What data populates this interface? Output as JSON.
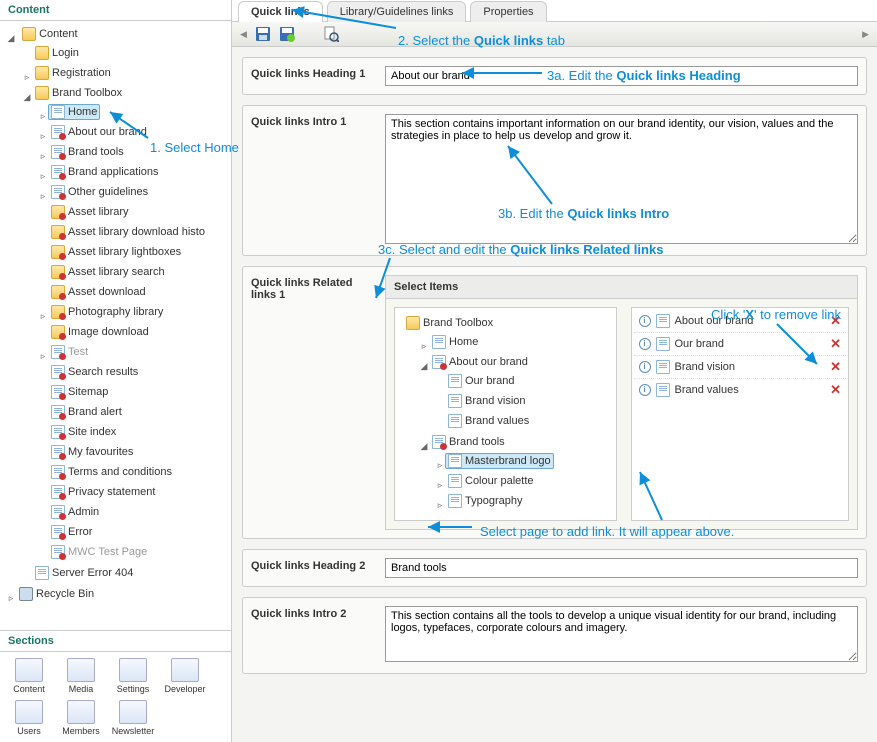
{
  "leftPanel": {
    "title": "Content",
    "tree": {
      "root": "Content",
      "login": "Login",
      "registration": "Registration",
      "brandToolbox": "Brand Toolbox",
      "home": "Home",
      "aboutBrand": "About our brand",
      "brandTools": "Brand tools",
      "brandApplications": "Brand applications",
      "otherGuidelines": "Other guidelines",
      "assetLibrary": "Asset library",
      "assetLibraryDownloadHistory": "Asset library download histo",
      "assetLibraryLightboxes": "Asset library lightboxes",
      "assetLibrarySearch": "Asset library search",
      "assetDownload": "Asset download",
      "photographyLibrary": "Photography library",
      "imageDownload": "Image download",
      "test": "Test",
      "searchResults": "Search results",
      "sitemap": "Sitemap",
      "brandAlert": "Brand alert",
      "siteIndex": "Site index",
      "myFavourites": "My favourites",
      "termsConditions": "Terms and conditions",
      "privacyStatement": "Privacy statement",
      "admin": "Admin",
      "error": "Error",
      "mwcTestPage": "MWC Test Page",
      "serverError": "Server Error 404",
      "recycleBin": "Recycle Bin"
    }
  },
  "sections": {
    "title": "Sections",
    "items": [
      "Content",
      "Media",
      "Settings",
      "Developer",
      "Users",
      "Members",
      "Newsletter"
    ]
  },
  "tabs": {
    "quickLinks": "Quick links",
    "libraryGuidelines": "Library/Guidelines links",
    "properties": "Properties"
  },
  "form": {
    "heading1Label": "Quick links Heading 1",
    "heading1Value": "About our brand",
    "intro1Label": "Quick links Intro 1",
    "intro1Value": "This section contains important information on our brand identity, our vision, values and the strategies in place to help us develop and grow it.",
    "relatedLinks1Label": "Quick links Related links 1",
    "selectItemsLabel": "Select Items",
    "heading2Label": "Quick links Heading 2",
    "heading2Value": "Brand tools",
    "intro2Label": "Quick links Intro 2",
    "intro2Value": "This section contains all the tools to develop a unique visual identity for our brand, including logos, typefaces, corporate colours and imagery."
  },
  "miniTree": {
    "brandToolbox": "Brand Toolbox",
    "home": "Home",
    "aboutOurBrand": "About our brand",
    "ourBrand": "Our brand",
    "brandVision": "Brand vision",
    "brandValues": "Brand values",
    "brandTools": "Brand tools",
    "masterbrandLogo": "Masterbrand logo",
    "colourPalette": "Colour palette",
    "typography": "Typography"
  },
  "selectedItems": [
    "About our brand",
    "Our brand",
    "Brand vision",
    "Brand values"
  ],
  "annotations": {
    "a1": "1. Select Home",
    "a2_pre": "2. Select the ",
    "a2_bold": "Quick links",
    "a2_post": " tab",
    "a3a_pre": "3a. Edit the ",
    "a3a_bold": "Quick links Heading",
    "a3b_pre": "3b. Edit the ",
    "a3b_bold": "Quick links Intro",
    "a3c_pre": "3c. Select and edit the ",
    "a3c_bold": "Quick links Related links",
    "clickX_pre": "Click '",
    "clickX_bold": "X",
    "clickX_post": "' to remove link",
    "selectPage": "Select page to add link. It will appear above."
  }
}
